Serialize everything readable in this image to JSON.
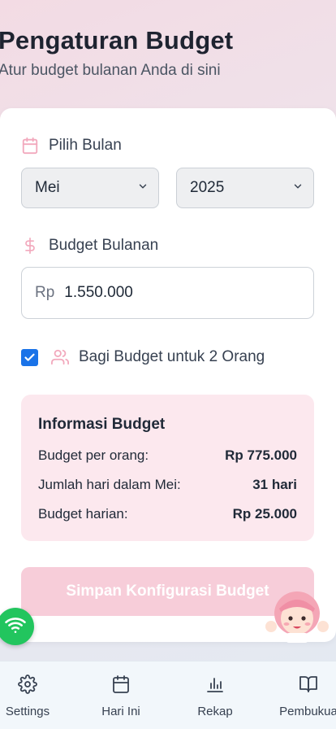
{
  "header": {
    "title": "Pengaturan Budget",
    "subtitle": "Atur budget bulanan Anda di sini"
  },
  "month_section": {
    "label": "Pilih Bulan",
    "icon": "calendar-icon",
    "month_selected": "Mei",
    "year_selected": "2025"
  },
  "budget_section": {
    "label": "Budget Bulanan",
    "icon": "dollar-icon",
    "currency_prefix": "Rp",
    "amount_value": "1.550.000"
  },
  "split": {
    "checked": true,
    "label": "Bagi Budget untuk 2 Orang",
    "icon": "users-icon"
  },
  "info": {
    "title": "Informasi Budget",
    "rows": [
      {
        "label": "Budget per orang:",
        "value": "Rp 775.000"
      },
      {
        "label": "Jumlah hari dalam Mei:",
        "value": "31 hari"
      },
      {
        "label": "Budget harian:",
        "value": "Rp 25.000"
      }
    ]
  },
  "save_button": {
    "label": "Simpan Konfigurasi Budget"
  },
  "nav": {
    "items": [
      {
        "label": "Settings",
        "icon": "gear-icon"
      },
      {
        "label": "Hari Ini",
        "icon": "calendar-icon"
      },
      {
        "label": "Rekap",
        "icon": "bar-chart-icon"
      },
      {
        "label": "Pembukua",
        "icon": "book-icon"
      }
    ]
  },
  "colors": {
    "accent_pink": "#f7cdd9",
    "info_bg": "#fce8ee",
    "checkbox_blue": "#1a73e8",
    "wifi_green": "#22c55e"
  }
}
